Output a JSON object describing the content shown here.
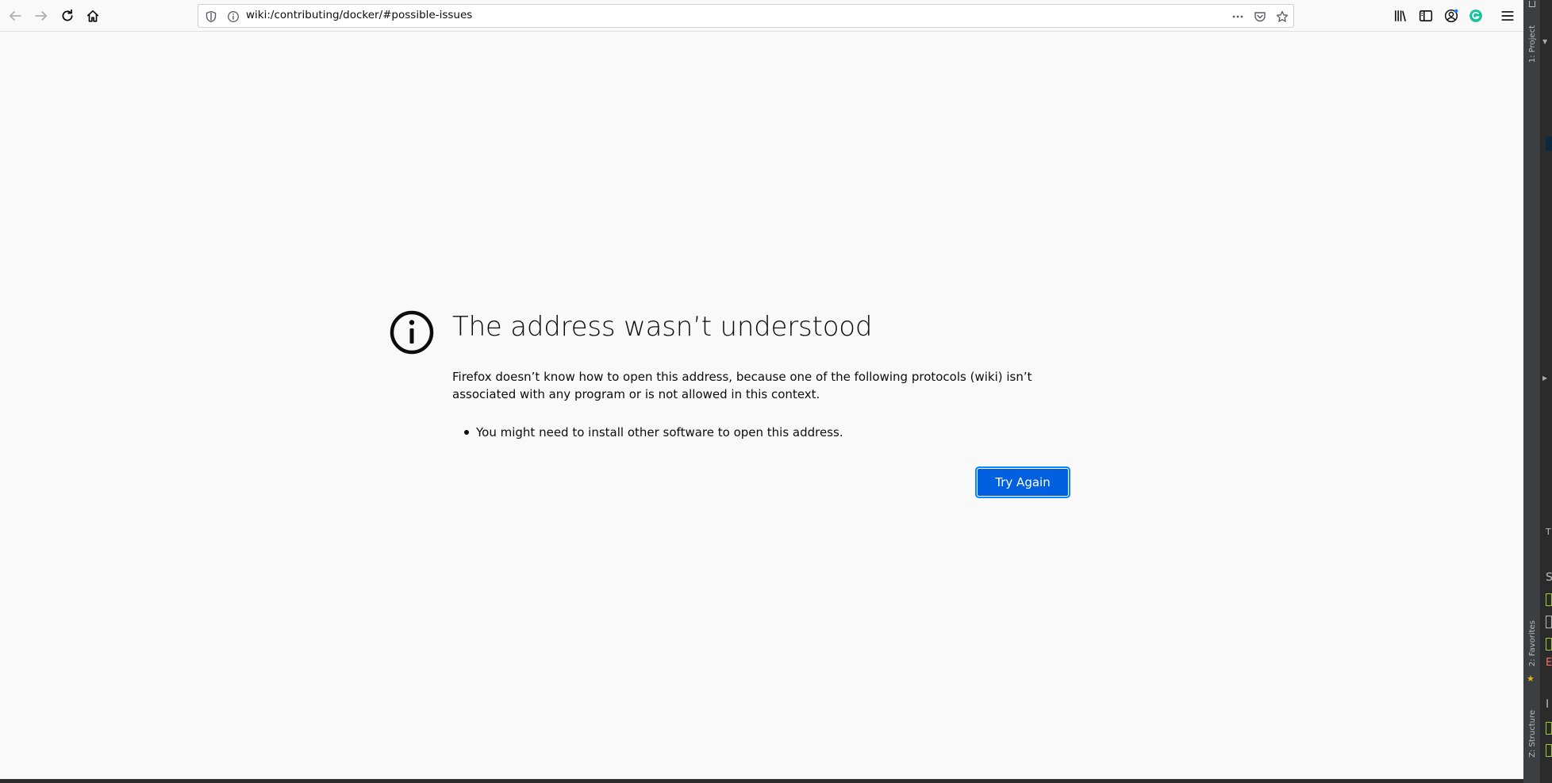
{
  "toolbar": {
    "url": "wiki:/contributing/docker/#possible-issues",
    "back_icon": "arrow-left-icon",
    "forward_icon": "arrow-right-icon",
    "reload_icon": "reload-icon",
    "home_icon": "home-icon"
  },
  "error_page": {
    "title": "The address wasn’t understood",
    "description": "Firefox doesn’t know how to open this address, because one of the following protocols (wiki) isn’t associated with any program or is not allowed in this context.",
    "list": [
      "You might need to install other software to open this address."
    ],
    "try_again_label": "Try Again"
  },
  "ide": {
    "tab_project": "1: Project",
    "tab_favorites": "2: Favorites",
    "tab_structure": "Z: Structure",
    "partial_letters": [
      "T",
      "S",
      "E",
      "I"
    ]
  },
  "colors": {
    "accent": "#0060df",
    "focus_ring": "#0a84ff",
    "page_bg": "#f9f9fa",
    "grammarly": "#15c39a"
  }
}
